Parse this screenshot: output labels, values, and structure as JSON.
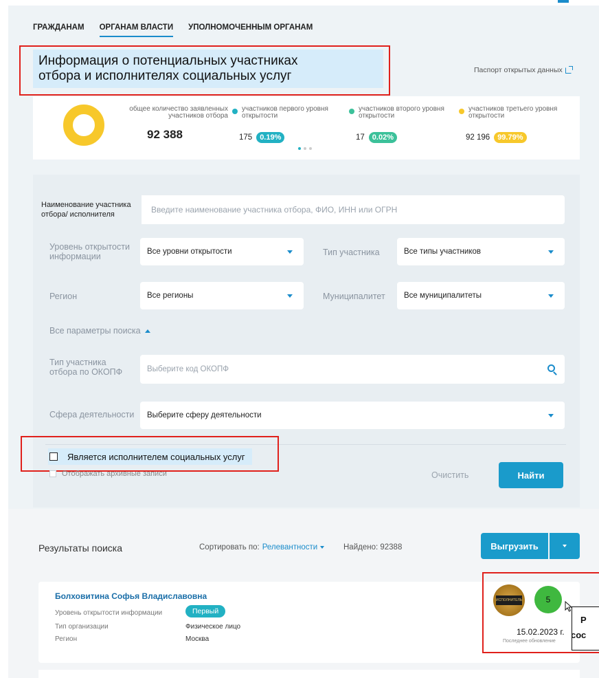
{
  "nav": {
    "items": [
      {
        "label": "ГРАЖДАНАМ",
        "active": false
      },
      {
        "label": "ОРГАНАМ ВЛАСТИ",
        "active": true
      },
      {
        "label": "УПОЛНОМОЧЕННЫМ ОРГАНАМ",
        "active": false
      }
    ]
  },
  "page": {
    "title_line1": "Информация о потенциальных участниках",
    "title_line2": "отбора и исполнителях социальных услуг",
    "passport_link": "Паспорт открытых данных"
  },
  "stats": {
    "total_label": "общее количество заявленных участников отбора",
    "total_value": "92 388",
    "items": [
      {
        "label": "участников первого уровня открытости",
        "count": "175",
        "percent": "0.19%",
        "color": "#22b1c3"
      },
      {
        "label": "участников второго уровня открытости",
        "count": "17",
        "percent": "0.02%",
        "color": "#3cc19a"
      },
      {
        "label": "участников третьего уровня открытости",
        "count": "92 196",
        "percent": "99.79%",
        "color": "#f7c82b"
      }
    ]
  },
  "filters": {
    "name_label": "Наименование участника отбора/ исполнителя",
    "name_placeholder": "Введите наименование участника отбора, ФИО, ИНН или ОГРН",
    "level_label": "Уровень открытости информации",
    "level_value": "Все уровни открытости",
    "type_label": "Тип участника",
    "type_value": "Все типы участников",
    "region_label": "Регион",
    "region_value": "Все регионы",
    "municipality_label": "Муниципалитет",
    "municipality_value": "Все муниципалитеты",
    "all_params": "Все параметры поиска",
    "okopf_label": "Тип участника отбора по ОКОПФ",
    "okopf_placeholder": "Выберите код ОКОПФ",
    "sphere_label": "Сфера деятельности",
    "sphere_placeholder": "Выберите сферу деятельности",
    "is_executor_label": "Является исполнителем социальных услуг",
    "archive_label": "Отображать архивные записи",
    "clear_label": "Очистить",
    "find_label": "Найти"
  },
  "results": {
    "title": "Результаты поиска",
    "sort_label": "Сортировать по:",
    "sort_value": "Релевантности",
    "found": "Найдено: 92388",
    "export_label": "Выгрузить"
  },
  "card": {
    "name": "Болховитина Софья Владиславовна",
    "level_key": "Уровень открытости информации",
    "level_value": "Первый",
    "org_type_key": "Тип организации",
    "org_type_value": "Физическое лицо",
    "region_key": "Регион",
    "region_value": "Москва",
    "seal_text": "ИСПОЛНИТЕЛЬ",
    "rating": "5",
    "date": "15.02.2023 г.",
    "date_caption": "Последнее обновление"
  },
  "callout": {
    "line1": "Р",
    "line2": "сос"
  }
}
